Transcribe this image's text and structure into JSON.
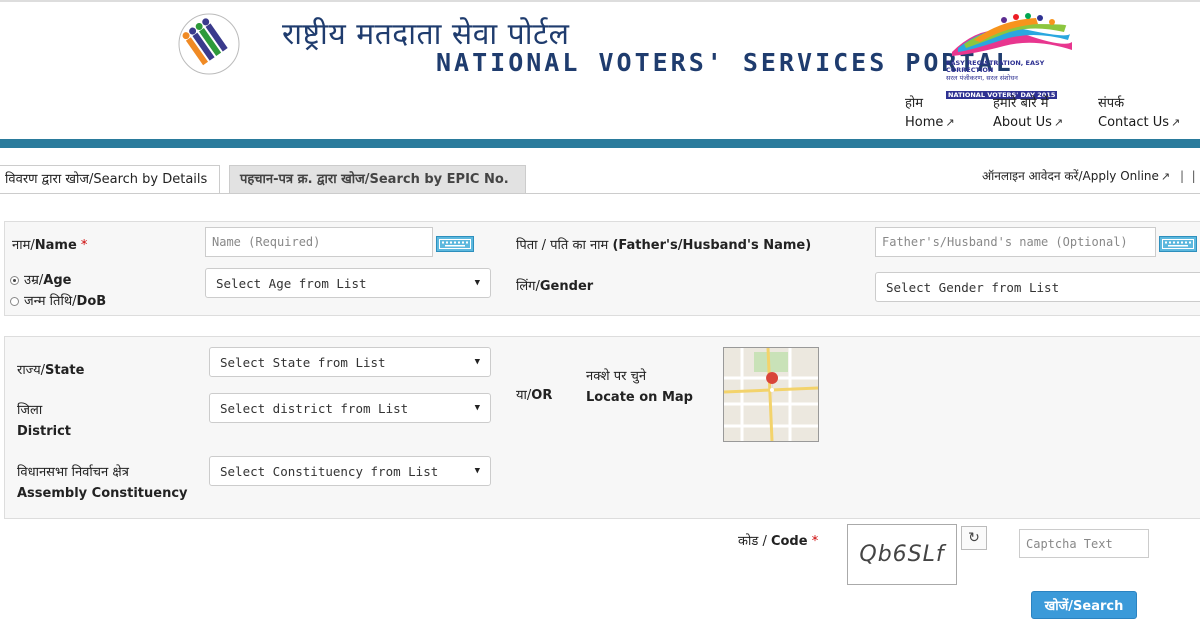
{
  "header": {
    "hindi_title": "राष्ट्रीय मतदाता सेवा पोर्टल",
    "english_title": "NATIONAL VOTERS' SERVICES PORTAL",
    "badge": {
      "line1": "EASY REGISTRATION, EASY CORRECTION",
      "line2": "सरल पंजीकरण, सरल संशोधन",
      "line3": "NATIONAL VOTERS' DAY 2015"
    },
    "nav": [
      {
        "hi": "होम",
        "en": "Home"
      },
      {
        "hi": "हमारे बारे में",
        "en": "About Us"
      },
      {
        "hi": "संपर्क",
        "en": "Contact Us"
      }
    ]
  },
  "tabs": {
    "active": "विवरण द्वारा खोज/Search by Details",
    "inactive": "पहचान-पत्र क्र. द्वारा खोज/Search by EPIC No."
  },
  "apply_online": "ऑनलाइन आवेदन करें/Apply Online",
  "form": {
    "name": {
      "hi": "नाम/",
      "en": "Name",
      "required": "*",
      "placeholder": "Name (Required)"
    },
    "father": {
      "hi": "पिता / पति का नाम ",
      "en": "(Father's/Husband's Name)",
      "placeholder": "Father's/Husband's name (Optional)"
    },
    "age": {
      "hi": "उम्र/",
      "en": "Age"
    },
    "dob": {
      "hi": "जन्म तिथि/",
      "en": "DoB"
    },
    "age_select": "Select Age from List",
    "gender": {
      "hi": "लिंग/",
      "en": "Gender"
    },
    "gender_select": "Select Gender from List",
    "state": {
      "hi": "राज्य/",
      "en": "State"
    },
    "state_select": "Select State from List",
    "district": {
      "hi": "जिला",
      "en": "District"
    },
    "district_select": "Select district from List",
    "constituency": {
      "hi": "विधानसभा निर्वाचन क्षेत्र",
      "en": "Assembly Constituency"
    },
    "constituency_select": "Select Constituency from List",
    "or": {
      "hi": "या/",
      "en": "OR"
    },
    "map": {
      "hi": "नक्शे पर चुने",
      "en": "Locate on Map"
    },
    "code": {
      "hi": "कोड / ",
      "en": "Code",
      "required": "*"
    },
    "captcha_image_text": "Qb6SLf",
    "captcha_placeholder": "Captcha Text",
    "search_button": "खोजें/Search"
  },
  "colors": {
    "title_blue": "#1f3c6e",
    "teal_bar": "#2a7b9c",
    "search_button": "#3b9ad9",
    "required": "#cc0000"
  }
}
